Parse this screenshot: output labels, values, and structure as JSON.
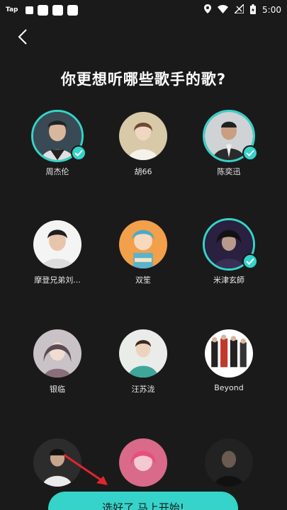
{
  "status_bar": {
    "app_label": "Tap",
    "time": "5:00"
  },
  "page": {
    "title": "你更想听哪些歌手的歌?"
  },
  "artists": [
    {
      "name": "周杰伦",
      "selected": true
    },
    {
      "name": "胡66",
      "selected": false
    },
    {
      "name": "陈奕迅",
      "selected": true
    },
    {
      "name": "摩登兄弟刘...",
      "selected": false
    },
    {
      "name": "双笙",
      "selected": false
    },
    {
      "name": "米津玄師",
      "selected": true
    },
    {
      "name": "银临",
      "selected": false
    },
    {
      "name": "汪苏泷",
      "selected": false
    },
    {
      "name": "Beyond",
      "selected": false
    },
    {
      "name": "",
      "selected": false
    },
    {
      "name": "",
      "selected": false
    },
    {
      "name": "",
      "selected": false
    }
  ],
  "start_button": {
    "label": "选好了 马上开始!"
  },
  "colors": {
    "background": "#1a1a1a",
    "accent": "#35d3c9"
  }
}
